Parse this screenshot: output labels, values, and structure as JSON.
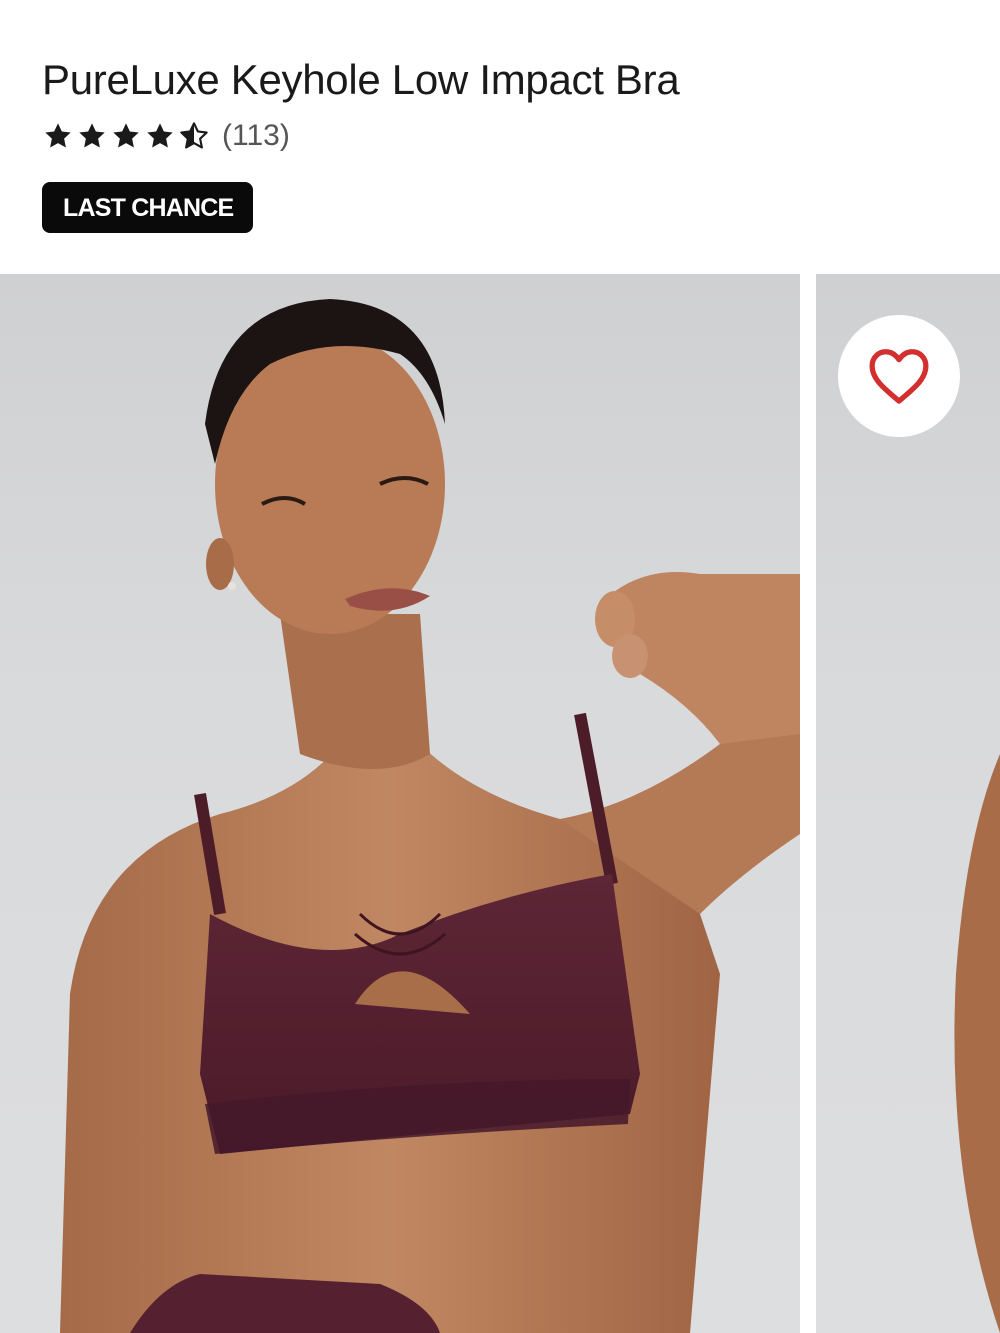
{
  "product": {
    "title": "PureLuxe Keyhole Low Impact Bra",
    "rating": 4.5,
    "rating_max": 5,
    "review_count": "(113)",
    "badge": "LAST CHANCE"
  },
  "gallery": {
    "images": [
      {
        "icon": "model-photo-front"
      },
      {
        "icon": "model-photo-next"
      }
    ]
  },
  "favorite": {
    "icon": "heart-outline-icon",
    "color": "#d32f2f"
  },
  "colors": {
    "badge_bg": "#0a0a0a",
    "star": "#1a1a1a",
    "photo_bg": "#d9dadc",
    "garment": "#55202f",
    "skin": "#b57a55"
  }
}
